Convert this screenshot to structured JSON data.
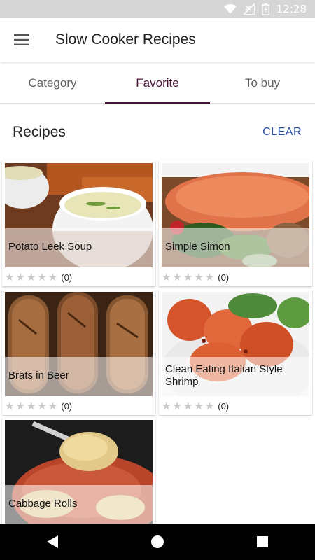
{
  "status_bar": {
    "time": "12:28"
  },
  "app_bar": {
    "title": "Slow Cooker Recipes"
  },
  "tabs": [
    {
      "label": "Category"
    },
    {
      "label": "Favorite"
    },
    {
      "label": "To buy"
    }
  ],
  "section": {
    "title": "Recipes",
    "clear_label": "CLEAR"
  },
  "recipes": [
    {
      "name": "Potato Leek Soup",
      "rating_count": "(0)"
    },
    {
      "name": "Simple Simon",
      "rating_count": "(0)"
    },
    {
      "name": "Brats in Beer",
      "rating_count": "(0)"
    },
    {
      "name": "Clean Eating Italian Style Shrimp",
      "rating_count": "(0)"
    },
    {
      "name": "Cabbage Rolls",
      "rating_count": ""
    }
  ],
  "stars_glyph": "★★★★★",
  "colors": {
    "accent": "#4a1238",
    "link": "#2a4fa0"
  }
}
